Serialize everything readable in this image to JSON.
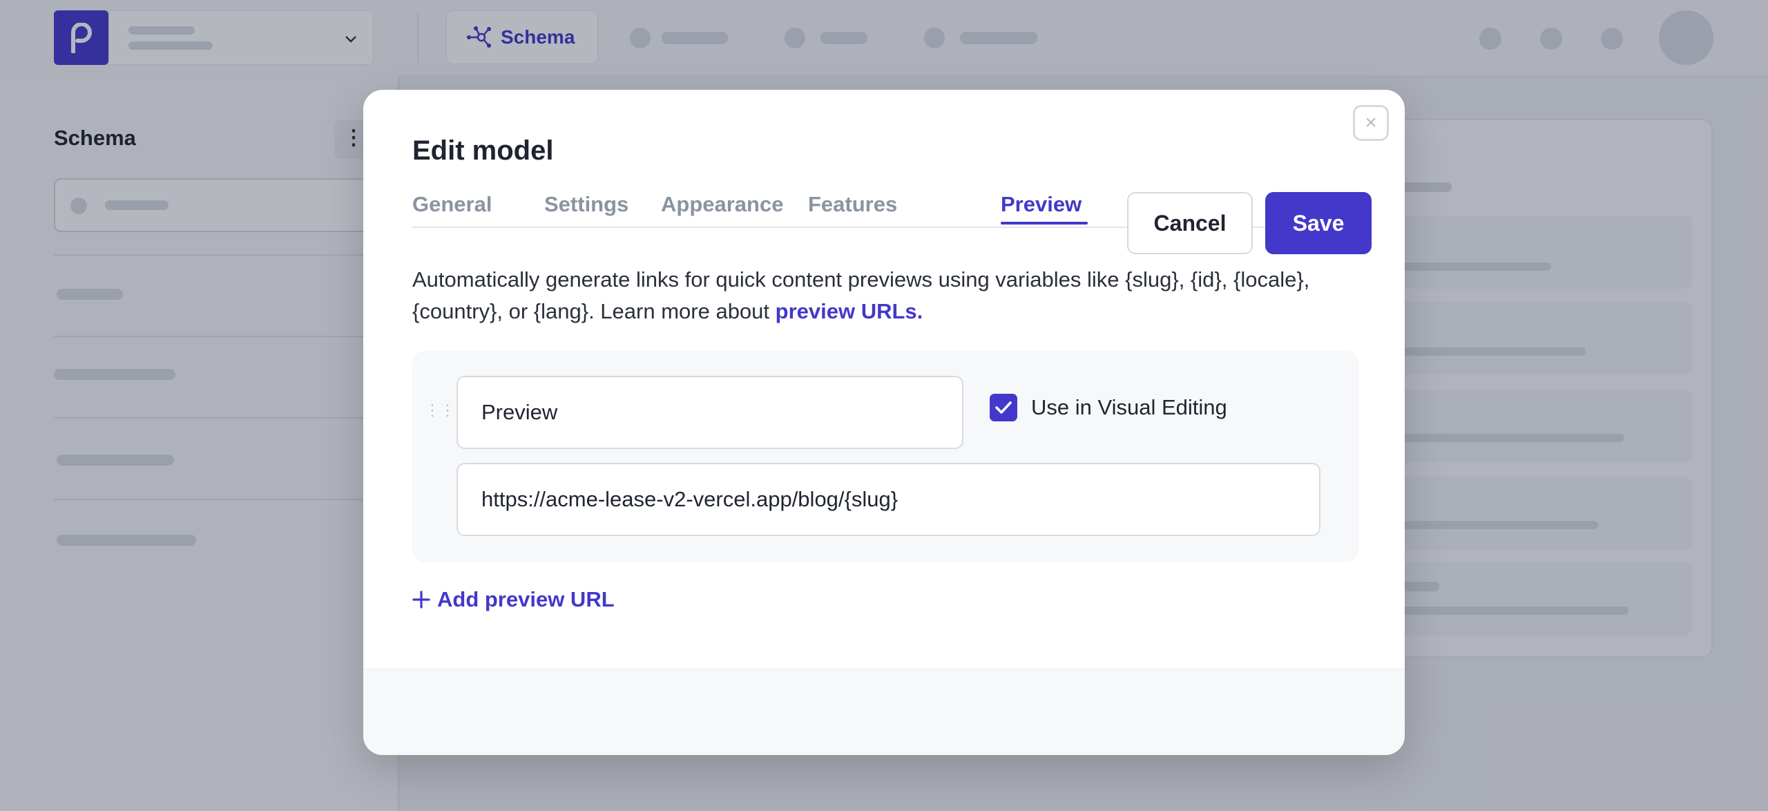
{
  "header": {
    "active_tab_label": "Schema"
  },
  "sidebar": {
    "title": "Schema",
    "more_icon": "⋮"
  },
  "modal": {
    "title": "Edit model",
    "close_icon": "×",
    "tabs": [
      {
        "label": "General",
        "active": false
      },
      {
        "label": "Settings",
        "active": false
      },
      {
        "label": "Appearance",
        "active": false
      },
      {
        "label": "Features",
        "active": false
      },
      {
        "label": "Preview",
        "active": true
      }
    ],
    "description": "Automatically generate links for quick content previews using variables like {slug}, {id}, {locale}, {country}, or {lang}. Learn more about ",
    "description_link": "preview URLs.",
    "preview_entry": {
      "name_value": "Preview",
      "visual_editing_label": "Use in Visual Editing",
      "visual_editing_checked": true,
      "url_value": "https://acme-lease-v2-vercel.app/blog/{slug}"
    },
    "add_label": "Add preview URL",
    "cancel_label": "Cancel",
    "save_label": "Save"
  },
  "colors": {
    "accent": "#4338ca",
    "overlay": "rgba(25,30,55,0.32)"
  }
}
